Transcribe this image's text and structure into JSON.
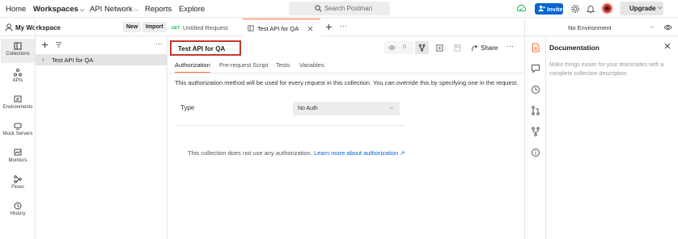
{
  "topnav": {
    "items": [
      {
        "label": "Home"
      },
      {
        "label": "Workspaces"
      },
      {
        "label": "API Network"
      },
      {
        "label": "Reports"
      },
      {
        "label": "Explore"
      }
    ],
    "search_placeholder": "Search Postman",
    "invite_label": "Invite",
    "upgrade_label": "Upgrade"
  },
  "workspace": {
    "name": "My Workspace",
    "new_label": "New",
    "import_label": "Import"
  },
  "rail": {
    "items": [
      {
        "label": "Collections",
        "icon": "collections-icon"
      },
      {
        "label": "APIs",
        "icon": "apis-icon"
      },
      {
        "label": "Environments",
        "icon": "environments-icon"
      },
      {
        "label": "Mock Servers",
        "icon": "mock-servers-icon"
      },
      {
        "label": "Monitors",
        "icon": "monitors-icon"
      },
      {
        "label": "Flows",
        "icon": "flows-icon"
      },
      {
        "label": "History",
        "icon": "history-icon"
      }
    ]
  },
  "sidebar": {
    "collections": [
      {
        "name": "Test API for QA"
      }
    ]
  },
  "tabs": [
    {
      "method": "GET",
      "title": "Untitled Request"
    },
    {
      "title": "Test API for QA"
    }
  ],
  "environment": {
    "selected": "No Environment"
  },
  "main": {
    "collection_name": "Test API for QA",
    "watch_count": "0",
    "share_label": "Share",
    "subtabs": [
      {
        "label": "Authorization"
      },
      {
        "label": "Pre-request Script"
      },
      {
        "label": "Tests"
      },
      {
        "label": "Variables"
      }
    ],
    "description": "This authorization method will be used for every request in this collection. You can override this by specifying one in the request.",
    "type_label": "Type",
    "auth_type": "No Auth",
    "no_auth_text": "This collection does not use any authorization.",
    "learn_more": "Learn more about authorization ↗"
  },
  "documentation": {
    "title": "Documentation",
    "hint": "Make things easier for your teammates with a complete collection description."
  },
  "colors": {
    "accent": "#ff6c37",
    "primary": "#0265d2",
    "highlight_border": "#c0392b"
  }
}
